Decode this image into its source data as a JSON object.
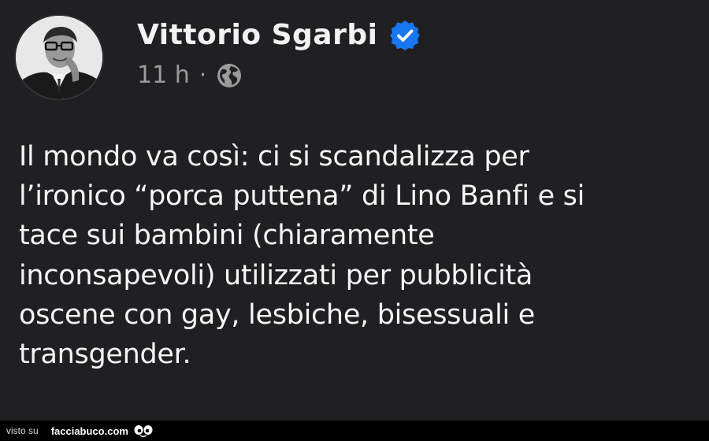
{
  "post": {
    "author": "Vittorio Sgarbi",
    "verified_icon": "verified-badge-icon",
    "time": "11 h",
    "separator": "·",
    "audience_icon": "globe-icon",
    "text": "Il mondo va così: ci si scandalizza per\nl’ironico “porca puttena” di Lino Banfi e si\ntace sui bambini (chiaramente\ninconsapevoli) utilizzati per pubblicità\noscene con gay, lesbiche, bisessuali e\ntransgender."
  },
  "footer": {
    "prefix": "visto su",
    "site": "facciabuco.com",
    "logo_icon": "eyes-logo-icon"
  },
  "colors": {
    "background": "#202022",
    "text": "#f5f5f5",
    "meta": "#9b9b9b",
    "verified": "#1877f2",
    "footer_bg": "#000000"
  }
}
